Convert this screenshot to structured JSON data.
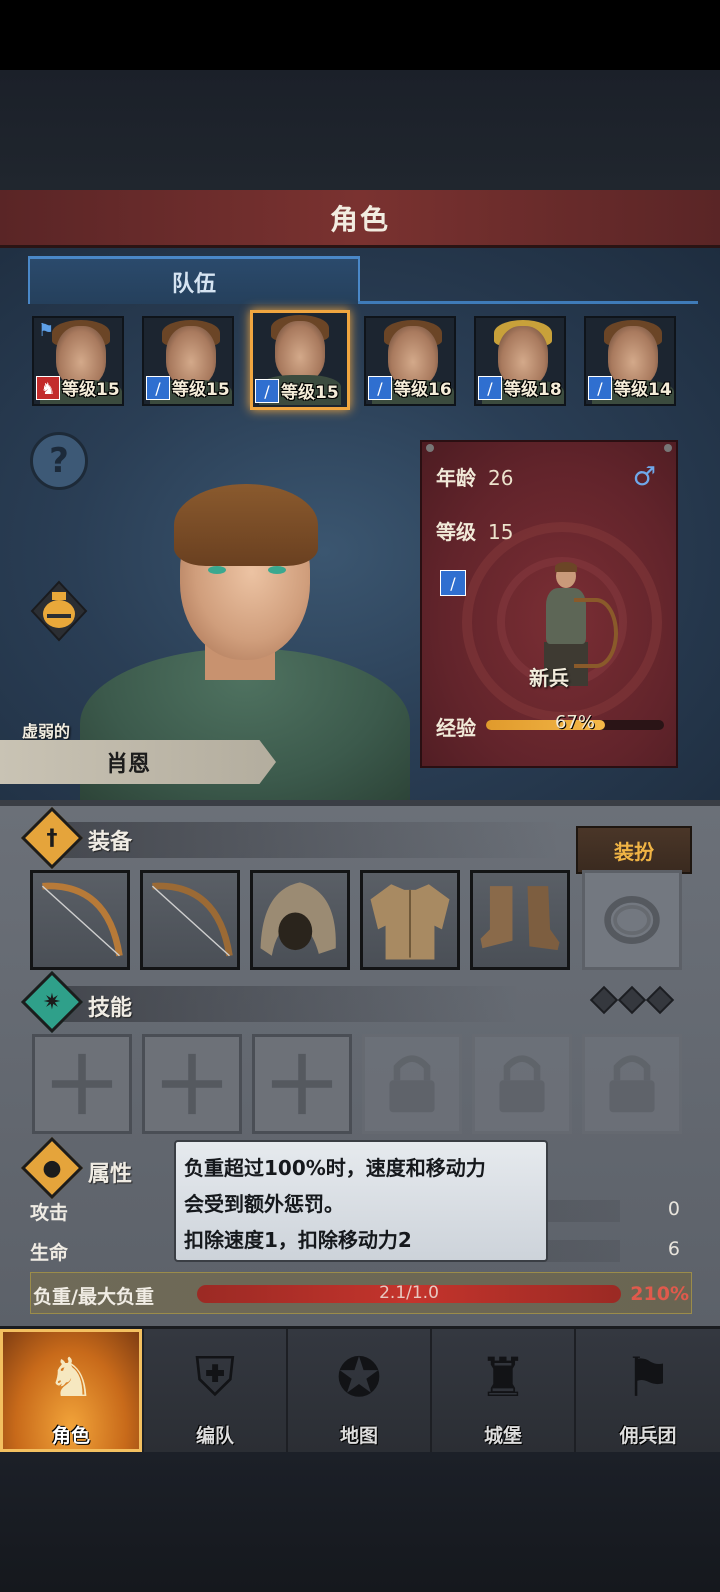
{
  "title": "角色",
  "tab_team": "队伍",
  "team": [
    {
      "level": "等级15",
      "badge": "flag-red-icon",
      "leader": true
    },
    {
      "level": "等级15",
      "badge": "sword-icon",
      "leader": false
    },
    {
      "level": "等级15",
      "badge": "sword-icon",
      "leader": false,
      "selected": true
    },
    {
      "level": "等级16",
      "badge": "sword-icon",
      "leader": false
    },
    {
      "level": "等级18",
      "badge": "sword-icon",
      "leader": false
    },
    {
      "level": "等级14",
      "badge": "sword-icon",
      "leader": false
    }
  ],
  "character": {
    "trait": "虚弱的",
    "name": "肖恩",
    "age_label": "年龄",
    "age": "26",
    "gender_symbol": "♂",
    "level_label": "等级",
    "level": "15",
    "class": "新兵",
    "xp_label": "经验",
    "xp": "67%",
    "xp_fraction": 0.67
  },
  "equipment": {
    "label": "装备",
    "dress_button": "装扮",
    "slots": [
      "bow",
      "bow",
      "hood",
      "tunic",
      "boots",
      "ring-empty"
    ]
  },
  "skills": {
    "label": "技能",
    "slots": [
      "cross",
      "cross",
      "cross",
      "locked",
      "locked",
      "locked"
    ]
  },
  "attributes": {
    "label": "属性",
    "attack_label": "攻击",
    "attack": "0",
    "health_label": "生命",
    "health": "6",
    "load_label": "负重/最大负重",
    "load": "2.1/1.0",
    "load_pct": "210%"
  },
  "tooltip": {
    "line1": "负重超过100%时，速度和移动力",
    "line2": "会受到额外惩罚。",
    "line3": "扣除速度1，扣除移动力2"
  },
  "nav": [
    {
      "label": "角色",
      "icon": "knight-icon",
      "active": true
    },
    {
      "label": "编队",
      "icon": "helmet-icon",
      "active": false
    },
    {
      "label": "地图",
      "icon": "compass-map-icon",
      "active": false
    },
    {
      "label": "城堡",
      "icon": "castle-icon",
      "active": false
    },
    {
      "label": "佣兵团",
      "icon": "banner-icon",
      "active": false
    }
  ],
  "colors": {
    "selected_border": "#f0a640",
    "xp_bar": "#f0b040",
    "load_bar": "#c4342c",
    "load_pct": "#e05a4c",
    "dress_text": "#f0b445"
  }
}
